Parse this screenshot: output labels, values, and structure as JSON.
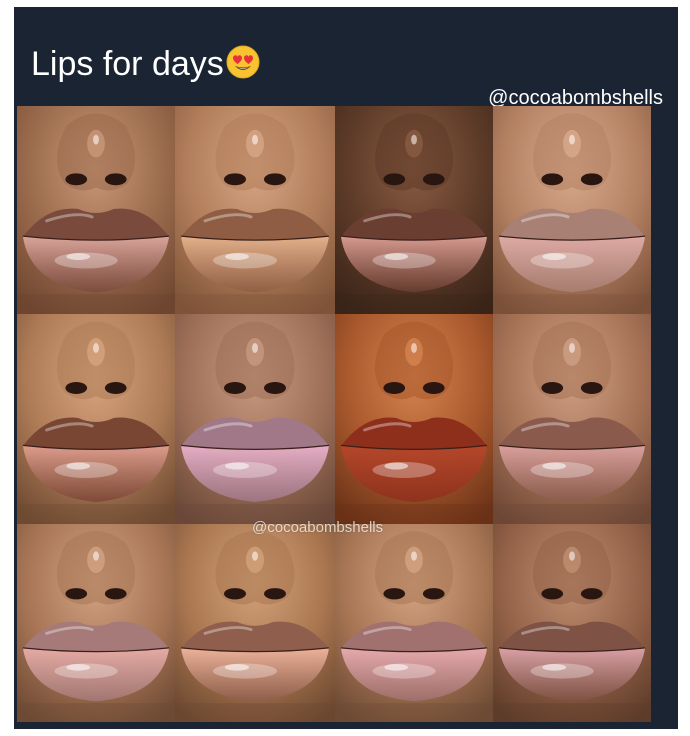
{
  "post": {
    "caption": "Lips for days",
    "caption_emoji": "heart-eyes-emoji",
    "handle": "@cocoabombshells",
    "watermark": "@cocoabombshells"
  },
  "photos": [
    {
      "id": "lips-1",
      "skin": "#9a6a4c",
      "skin_shadow": "#6e4630",
      "upper_lip": "#7a4a3c",
      "lower_lip": "#d9a39a",
      "nose_hl": "#c99878"
    },
    {
      "id": "lips-2",
      "skin": "#b07c5a",
      "skin_shadow": "#7e5438",
      "upper_lip": "#8f5d44",
      "lower_lip": "#e3b08a",
      "nose_hl": "#d7a684"
    },
    {
      "id": "lips-3",
      "skin": "#5c3a28",
      "skin_shadow": "#3a2418",
      "upper_lip": "#6a3e30",
      "lower_lip": "#d69a90",
      "nose_hl": "#8a5c42"
    },
    {
      "id": "lips-4",
      "skin": "#b38062",
      "skin_shadow": "#7a5038",
      "upper_lip": "#a88074",
      "lower_lip": "#deaaa4",
      "nose_hl": "#d9aa8c"
    },
    {
      "id": "lips-5",
      "skin": "#ad7b56",
      "skin_shadow": "#6e4a32",
      "upper_lip": "#7a4634",
      "lower_lip": "#dc9c8c",
      "nose_hl": "#d7a47e"
    },
    {
      "id": "lips-6",
      "skin": "#9e7058",
      "skin_shadow": "#6a4838",
      "upper_lip": "#a07888",
      "lower_lip": "#e5adc4",
      "nose_hl": "#c79a80"
    },
    {
      "id": "lips-7",
      "skin": "#a8582c",
      "skin_shadow": "#6a3218",
      "upper_lip": "#8e2f1c",
      "lower_lip": "#b5472a",
      "nose_hl": "#d58450"
    },
    {
      "id": "lips-8",
      "skin": "#a67256",
      "skin_shadow": "#6e4836",
      "upper_lip": "#8a5a4c",
      "lower_lip": "#d9a09c",
      "nose_hl": "#d0a084"
    },
    {
      "id": "lips-9",
      "skin": "#a87656",
      "skin_shadow": "#6e4a34",
      "upper_lip": "#a57a78",
      "lower_lip": "#e5aba4",
      "nose_hl": "#d2a282"
    },
    {
      "id": "lips-10",
      "skin": "#a97650",
      "skin_shadow": "#6c4830",
      "upper_lip": "#8f5e4c",
      "lower_lip": "#ecb29a",
      "nose_hl": "#d3a27a"
    },
    {
      "id": "lips-11",
      "skin": "#a87654",
      "skin_shadow": "#6c4a34",
      "upper_lip": "#a0716e",
      "lower_lip": "#e6a9ae",
      "nose_hl": "#d5a482"
    },
    {
      "id": "lips-12",
      "skin": "#946248",
      "skin_shadow": "#5e3c2a",
      "upper_lip": "#7e5244",
      "lower_lip": "#d9a0a4",
      "nose_hl": "#c08e70"
    }
  ]
}
